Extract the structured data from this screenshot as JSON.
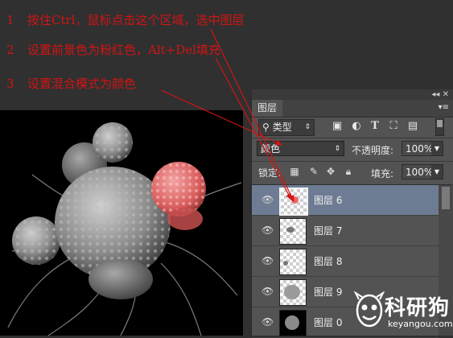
{
  "instructions": [
    {
      "num": "1",
      "text": "按住Ctrl，鼠标点击这个区域，选中图层"
    },
    {
      "num": "2",
      "text": "设置前景色为粉红色，Alt+Del填充"
    },
    {
      "num": "3",
      "text": "设置混合模式为颜色"
    }
  ],
  "panel": {
    "tab_label": "图层",
    "filter_type": "类型",
    "blend_mode": "颜色",
    "opacity_label": "不透明度:",
    "opacity_value": "100%",
    "lock_label": "锁定:",
    "fill_label": "填充:",
    "fill_value": "100%",
    "layers": [
      {
        "name": "图层 6",
        "selected": true
      },
      {
        "name": "图层 7",
        "selected": false
      },
      {
        "name": "图层 8",
        "selected": false
      },
      {
        "name": "图层 9",
        "selected": false
      },
      {
        "name": "图层 0",
        "selected": false
      }
    ]
  },
  "watermark": {
    "brand": "科研狗",
    "url": "keyangou.com"
  },
  "colors": {
    "annotation": "#d21414",
    "highlight_cell": "#e8696b",
    "selected_layer": "#6e7c93"
  }
}
